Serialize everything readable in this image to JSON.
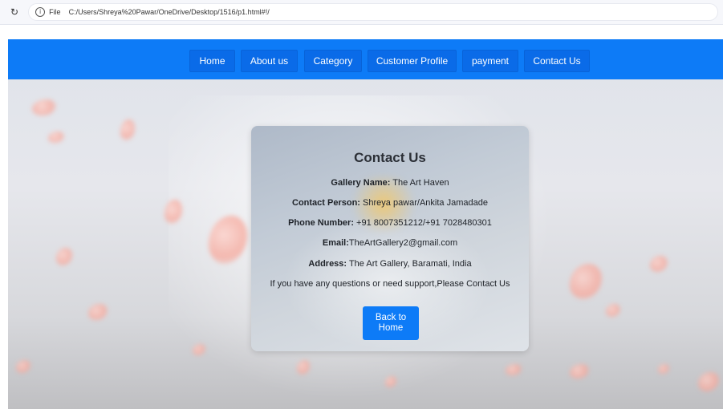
{
  "browser": {
    "reload_icon": "reload-icon",
    "site_info_label": "File",
    "url": "C:/Users/Shreya%20Pawar/OneDrive/Desktop/1516/p1.html#!/"
  },
  "nav": {
    "items": [
      {
        "label": "Home"
      },
      {
        "label": "About us"
      },
      {
        "label": "Category"
      },
      {
        "label": "Customer Profile"
      },
      {
        "label": "payment"
      },
      {
        "label": "Contact Us"
      }
    ],
    "background": "#0d7bf7"
  },
  "contact": {
    "title": "Contact Us",
    "gallery_name_label": "Gallery Name:",
    "gallery_name_value": " The Art Haven",
    "contact_person_label": "Contact Person:",
    "contact_person_value": " Shreya pawar/Ankita Jamadade",
    "phone_label": "Phone Number:",
    "phone_value": " +91 8007351212/+91 7028480301",
    "email_label": "Email:",
    "email_value": "TheArtGallery2@gmail.com",
    "address_label": "Address:",
    "address_value": " The Art Gallery, Baramati, India",
    "support_text": "If you have any questions or need support,Please Contact Us",
    "back_line1": "Back to",
    "back_line2": "Home"
  }
}
